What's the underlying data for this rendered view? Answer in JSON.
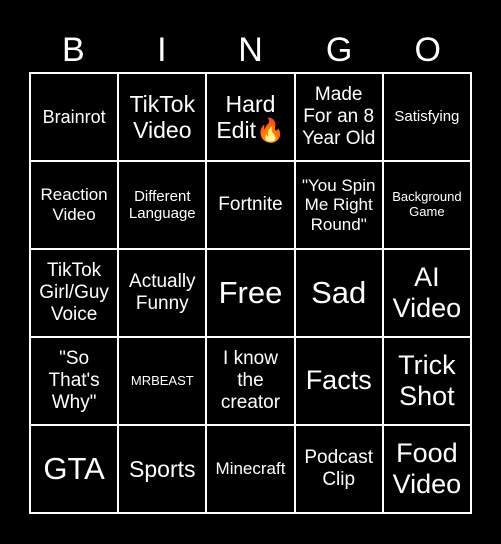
{
  "header": {
    "letters": [
      "B",
      "I",
      "N",
      "G",
      "O"
    ]
  },
  "grid": {
    "rows": [
      [
        "Brainrot",
        "TikTok\nVideo",
        "Hard\nEdit🔥",
        "Made\nFor an 8\nYear Old",
        "Satisfying"
      ],
      [
        "Reaction\nVideo",
        "Different\nLanguage",
        "Fortnite",
        "\"You Spin\nMe Right\nRound\"",
        "Background\nGame"
      ],
      [
        "TikTok\nGirl/Guy\nVoice",
        "Actually\nFunny",
        "Free",
        "Sad",
        "AI\nVideo"
      ],
      [
        "\"So\nThat's\nWhy\"",
        "MRBEAST",
        "I know\nthe\ncreator",
        "Facts",
        "Trick\nShot"
      ],
      [
        "GTA",
        "Sports",
        "Minecraft",
        "Podcast\nClip",
        "Food\nVideo"
      ]
    ]
  },
  "colors": {
    "background": "#000000",
    "text": "#ffffff",
    "border": "#ffffff"
  }
}
